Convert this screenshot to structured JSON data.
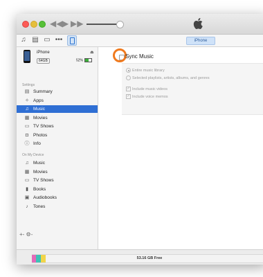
{
  "player": {
    "volume": 0.9
  },
  "navbar": {
    "device_tab": "iPhone",
    "icons": [
      "music-note-icon",
      "movie-icon",
      "tv-icon",
      "more-icon",
      "iphone-icon"
    ]
  },
  "device": {
    "name": "iPhone",
    "capacity": "64GB",
    "battery": "52%",
    "battery_level": 0.52
  },
  "sidebar": {
    "settings_header": "Settings",
    "settings": [
      {
        "label": "Summary",
        "icon": "summary-icon"
      },
      {
        "label": "Apps",
        "icon": "apps-icon"
      },
      {
        "label": "Music",
        "icon": "music-note-icon",
        "selected": true
      },
      {
        "label": "Movies",
        "icon": "film-icon"
      },
      {
        "label": "TV Shows",
        "icon": "tv-icon"
      },
      {
        "label": "Photos",
        "icon": "camera-icon"
      },
      {
        "label": "Info",
        "icon": "info-icon"
      }
    ],
    "device_header": "On My Device",
    "on_device": [
      {
        "label": "Music",
        "icon": "music-note-icon"
      },
      {
        "label": "Movies",
        "icon": "film-icon"
      },
      {
        "label": "TV Shows",
        "icon": "tv-icon"
      },
      {
        "label": "Books",
        "icon": "books-icon"
      },
      {
        "label": "Audiobooks",
        "icon": "audiobook-icon"
      },
      {
        "label": "Tones",
        "icon": "bell-icon"
      }
    ],
    "footer": "+- ⚙-"
  },
  "main": {
    "sync_title": "Sync Music",
    "sync_checked": false,
    "options": {
      "entire_library": "Entire music library",
      "selected": "Selected playlists, artists, albums, and genres",
      "include_videos": "Include music videos",
      "include_memos": "Include voice memos"
    }
  },
  "storage": {
    "free_label": "53.16 GB Free",
    "segments": [
      {
        "color": "#e36ab8",
        "fraction": 0.018
      },
      {
        "color": "#3ec1b6",
        "fraction": 0.02
      },
      {
        "color": "#f1d54a",
        "fraction": 0.02
      }
    ]
  },
  "colors": {
    "accent": "#2f6fd4",
    "highlight": "#f07a1e"
  }
}
